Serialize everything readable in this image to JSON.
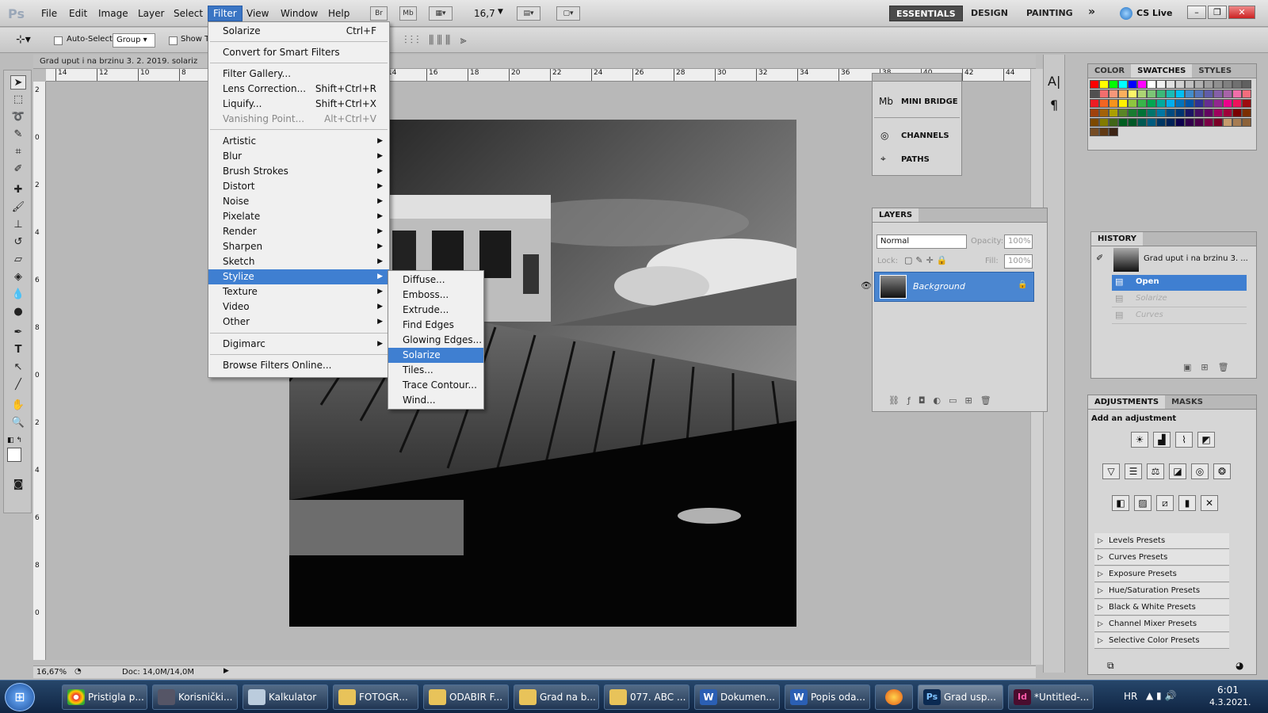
{
  "app": {
    "logo": "Ps"
  },
  "menubar": {
    "items": [
      "File",
      "Edit",
      "Image",
      "Layer",
      "Select",
      "Filter",
      "View",
      "Window",
      "Help"
    ],
    "active": "Filter",
    "mini_br": "Br",
    "mini_mb": "Mb",
    "zoom": "16,7",
    "workspaces": [
      "ESSENTIALS",
      "DESIGN",
      "PAINTING"
    ],
    "more": "»",
    "cslive": "CS Live"
  },
  "options": {
    "auto_select": "Auto-Select:",
    "group": "Group",
    "show": "Show T"
  },
  "document": {
    "tab_title": "Grad uput i na brzinu 3. 2. 2019. solariz",
    "zoom": "16,67%",
    "doc_info": "Doc: 14,0M/14,0M"
  },
  "ruler": {
    "top": [
      "14",
      "12",
      "10",
      "8",
      "6",
      "8",
      "10",
      "12",
      "14",
      "16",
      "18",
      "20",
      "22",
      "24",
      "26",
      "28",
      "30",
      "32",
      "34",
      "36",
      "38",
      "40",
      "42",
      "44"
    ],
    "left": [
      "2",
      "0",
      "2",
      "4",
      "6",
      "8",
      "0",
      "2",
      "4",
      "6",
      "8",
      "0"
    ]
  },
  "filter_menu": {
    "items": [
      {
        "label": "Solarize",
        "shortcut": "Ctrl+F"
      },
      {
        "label": "Convert for Smart Filters"
      },
      {
        "label": "Filter Gallery..."
      },
      {
        "label": "Lens Correction...",
        "shortcut": "Shift+Ctrl+R"
      },
      {
        "label": "Liquify...",
        "shortcut": "Shift+Ctrl+X"
      },
      {
        "label": "Vanishing Point...",
        "shortcut": "Alt+Ctrl+V",
        "disabled": true
      },
      {
        "label": "Artistic",
        "sub": true
      },
      {
        "label": "Blur",
        "sub": true
      },
      {
        "label": "Brush Strokes",
        "sub": true
      },
      {
        "label": "Distort",
        "sub": true
      },
      {
        "label": "Noise",
        "sub": true
      },
      {
        "label": "Pixelate",
        "sub": true
      },
      {
        "label": "Render",
        "sub": true
      },
      {
        "label": "Sharpen",
        "sub": true
      },
      {
        "label": "Sketch",
        "sub": true
      },
      {
        "label": "Stylize",
        "sub": true,
        "highlight": true
      },
      {
        "label": "Texture",
        "sub": true
      },
      {
        "label": "Video",
        "sub": true
      },
      {
        "label": "Other",
        "sub": true
      },
      {
        "label": "Digimarc",
        "sub": true
      },
      {
        "label": "Browse Filters Online..."
      }
    ]
  },
  "stylize_menu": {
    "items": [
      "Diffuse...",
      "Emboss...",
      "Extrude...",
      "Find Edges",
      "Glowing Edges...",
      "Solarize",
      "Tiles...",
      "Trace Contour...",
      "Wind..."
    ],
    "highlight": "Solarize"
  },
  "mini_panels": {
    "items": [
      "MINI BRIDGE",
      "CHANNELS",
      "PATHS"
    ]
  },
  "layers": {
    "tab": "LAYERS",
    "blend": "Normal",
    "opacity_label": "Opacity:",
    "opacity": "100%",
    "lock_label": "Lock:",
    "fill_label": "Fill:",
    "fill": "100%",
    "layer_name": "Background"
  },
  "color_panel": {
    "tabs": [
      "COLOR",
      "SWATCHES",
      "STYLES"
    ],
    "active": "SWATCHES"
  },
  "swatches": [
    "#ff0000",
    "#ffff00",
    "#00ff00",
    "#00ffff",
    "#0000ff",
    "#ff00ff",
    "#ffffff",
    "#f0f0f0",
    "#e0e0e0",
    "#d0d0d0",
    "#c0c0c0",
    "#b0b0b0",
    "#a0a0a0",
    "#909090",
    "#808080",
    "#707070",
    "#606060",
    "#505050",
    "#f26d6d",
    "#f7977a",
    "#fbaf5d",
    "#fff568",
    "#acd373",
    "#7cc576",
    "#3bb878",
    "#1abbb4",
    "#00bff3",
    "#438ccb",
    "#5574b9",
    "#605ca8",
    "#855fa8",
    "#a763a8",
    "#f06ea9",
    "#f26d7d",
    "#ed1c24",
    "#f26522",
    "#f7941d",
    "#fff200",
    "#8dc63f",
    "#39b54a",
    "#00a651",
    "#00a99d",
    "#00aeef",
    "#0072bc",
    "#0054a6",
    "#2e3192",
    "#662d91",
    "#92278f",
    "#ec008c",
    "#ed145b",
    "#9e0b0f",
    "#a0410d",
    "#a36209",
    "#aba000",
    "#598527",
    "#197b30",
    "#007236",
    "#00746b",
    "#0076a3",
    "#004a80",
    "#003471",
    "#1b1464",
    "#440e62",
    "#630460",
    "#9e005d",
    "#9e0039",
    "#790000",
    "#7b2e00",
    "#7d4900",
    "#827b00",
    "#406618",
    "#005e20",
    "#005826",
    "#005952",
    "#005b7f",
    "#003663",
    "#002157",
    "#0d004c",
    "#32004b",
    "#4b0049",
    "#7b0046",
    "#7a0026",
    "#c69c6d",
    "#a67c52",
    "#8c6239",
    "#754c24",
    "#603913",
    "#3c2415"
  ],
  "history": {
    "tab": "HISTORY",
    "snapshot": "Grad uput i na brzinu 3. ...",
    "steps": [
      {
        "label": "Open",
        "active": true
      },
      {
        "label": "Solarize",
        "dim": true
      },
      {
        "label": "Curves",
        "dim": true
      }
    ]
  },
  "adjustments": {
    "tabs": [
      "ADJUSTMENTS",
      "MASKS"
    ],
    "title": "Add an adjustment",
    "presets": [
      "Levels Presets",
      "Curves Presets",
      "Exposure Presets",
      "Hue/Saturation Presets",
      "Black & White Presets",
      "Channel Mixer Presets",
      "Selective Color Presets"
    ]
  },
  "taskbar": {
    "items": [
      "Pristigla p...",
      "Korisnički...",
      "Kalkulator",
      "FOTOGR...",
      "ODABIR F...",
      "Grad na b...",
      "077. ABC ...",
      "Dokumen...",
      "Popis oda...",
      "",
      "Grad usp...",
      "*Untitled-..."
    ],
    "lang": "HR",
    "time": "6:01",
    "date": "4.3.2021."
  }
}
